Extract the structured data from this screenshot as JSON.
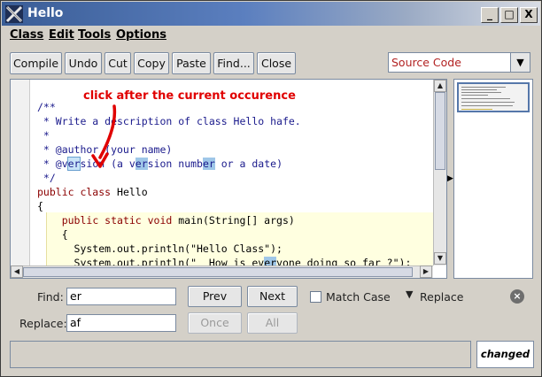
{
  "window": {
    "title": "Hello",
    "app_icon": "x-logo-icon"
  },
  "titlebar_buttons": {
    "minimize": "_",
    "maximize": "□",
    "close": "X"
  },
  "menu": [
    "Class",
    "Edit",
    "Tools",
    "Options"
  ],
  "toolbar": [
    "Compile",
    "Undo",
    "Cut",
    "Copy",
    "Paste",
    "Find...",
    "Close"
  ],
  "view_select": {
    "value": "Source Code"
  },
  "code": [
    "/**",
    " * Write a description of class Hello hafe.",
    " *",
    " * @author (your name)",
    " * @version (a version number or a date)",
    " */",
    "public class Hello",
    "{",
    "    public static void main(String[] args)",
    "    {",
    "      System.out.println(\"Hello Class\");",
    "      System.out.println(\"  How is everyone doing so far ?\");"
  ],
  "annotation": "click after the current occurence",
  "find_panel": {
    "find_label": "Find:",
    "find_value": "er",
    "replace_label": "Replace:",
    "replace_value": "af",
    "prev": "Prev",
    "next": "Next",
    "match_case": "Match Case",
    "replace_toggle": "Replace",
    "once": "Once",
    "all": "All"
  },
  "status": {
    "message": "",
    "changed": "changed"
  },
  "colors": {
    "highlight": "#9fc7e8",
    "annotation": "#e00000",
    "titlebar": "#3a5d96"
  }
}
